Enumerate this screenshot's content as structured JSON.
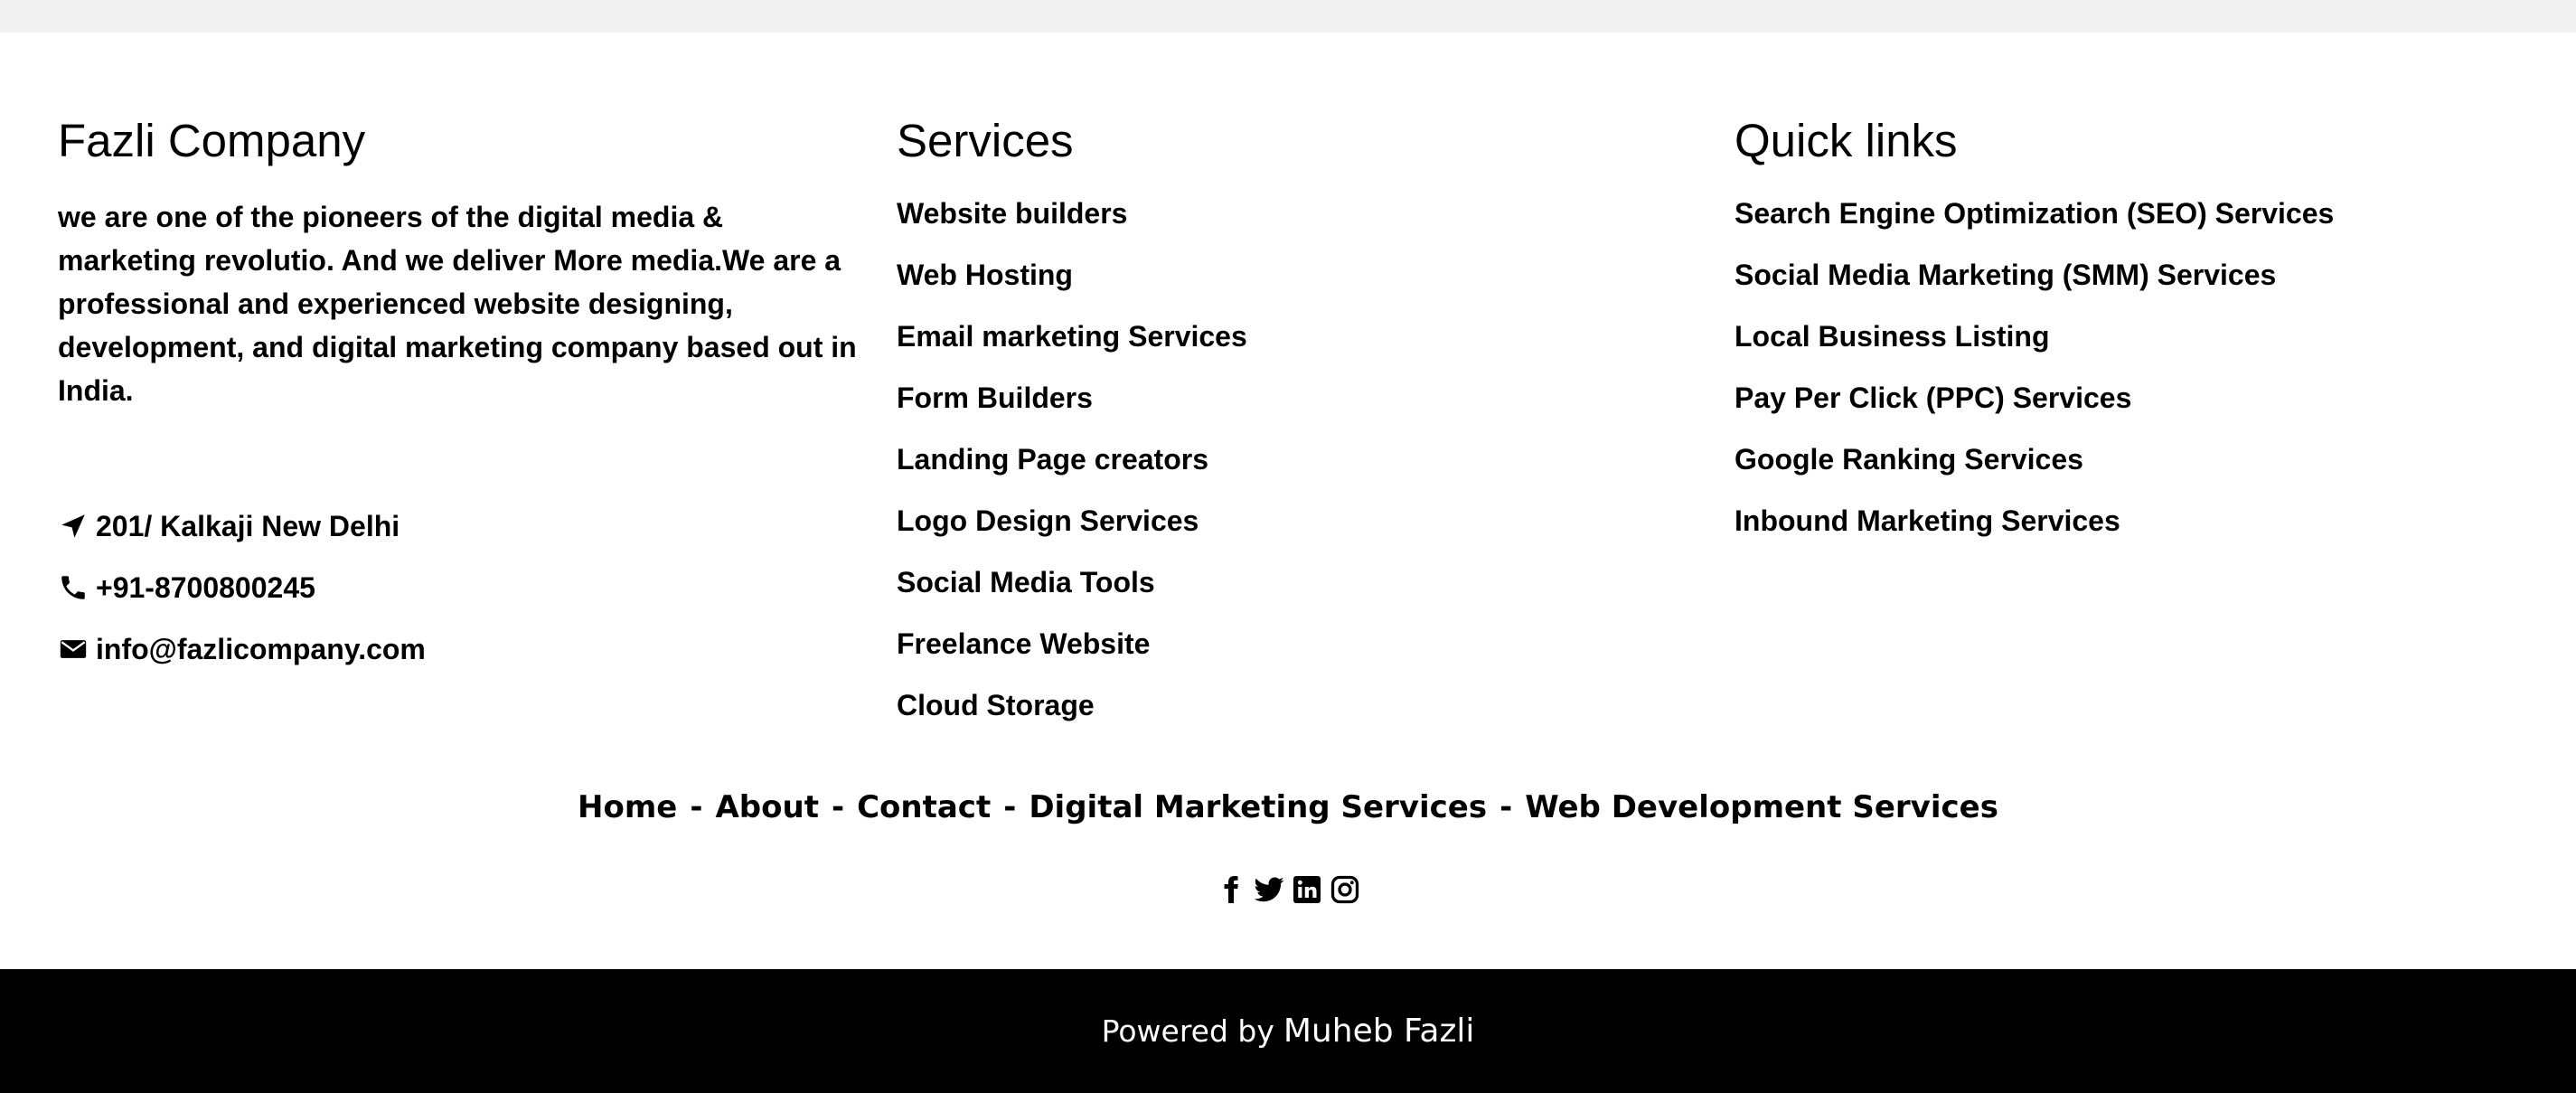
{
  "about": {
    "title": "Fazli Company",
    "text": "we are one of the pioneers of the digital media & marketing revolutio. And we deliver More media.We are a professional and experienced website designing, development, and digital marketing company based out in India.",
    "contacts": [
      {
        "icon": "location-arrow-icon",
        "text": "201/ Kalkaji New Delhi"
      },
      {
        "icon": "phone-icon",
        "text": "+91-8700800245"
      },
      {
        "icon": "envelope-icon",
        "text": "info@fazlicompany.com"
      }
    ]
  },
  "services": {
    "title": "Services",
    "items": [
      "Website builders",
      "Web Hosting",
      "Email marketing Services",
      "Form Builders",
      "Landing Page creators",
      "Logo Design Services",
      "Social Media Tools",
      "Freelance Website",
      "Cloud Storage"
    ]
  },
  "quick_links": {
    "title": "Quick links",
    "items": [
      "Search Engine Optimization (SEO) Services",
      "Social Media Marketing (SMM) Services",
      "Local Business Listing",
      "Pay Per Click (PPC) Services",
      "Google Ranking Services",
      "Inbound Marketing Services"
    ]
  },
  "bottom_nav": {
    "home": "Home",
    "about": "About",
    "contact": "Contact",
    "digital_marketing": "Digital Marketing Services",
    "web_development": "Web Development Services",
    "separator": "-"
  },
  "social": [
    "facebook-icon",
    "twitter-icon",
    "linkedin-icon",
    "instagram-icon"
  ],
  "footer": {
    "powered_by": "Powered by",
    "author": "Muheb Fazli"
  }
}
